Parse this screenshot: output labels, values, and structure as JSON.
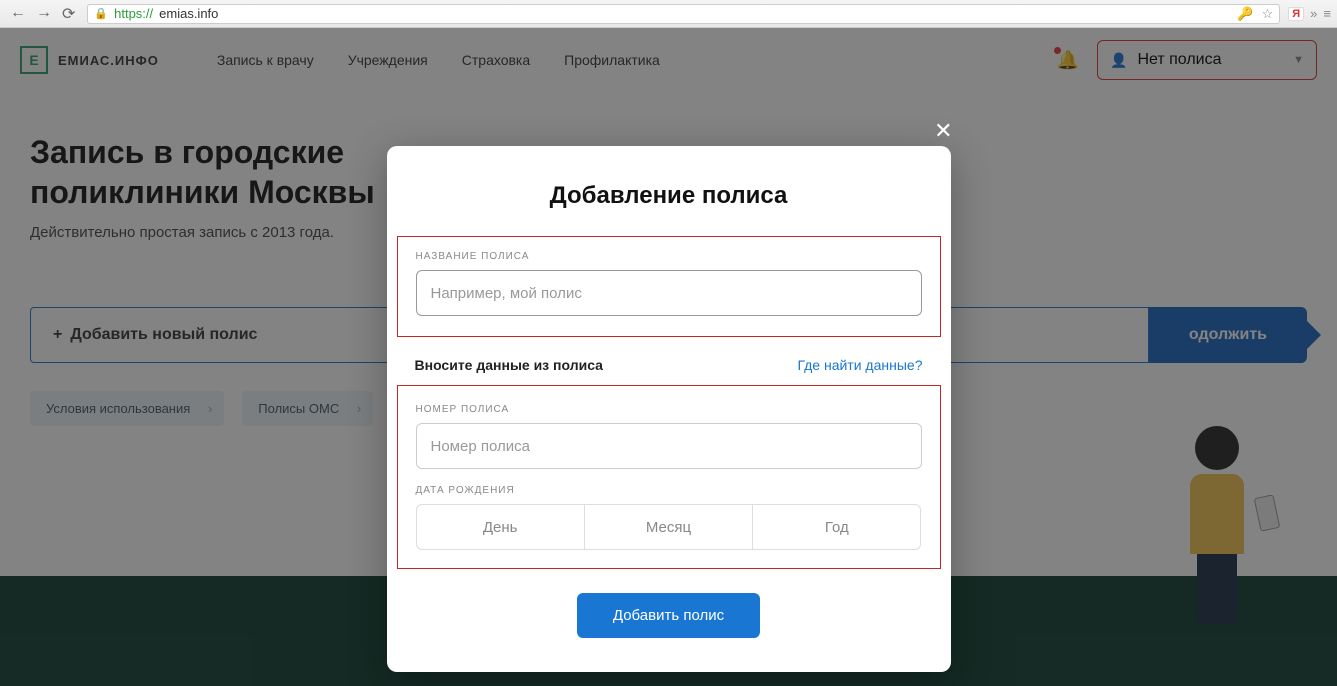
{
  "browser": {
    "url_scheme": "https://",
    "url_host": "emias.info"
  },
  "header": {
    "logo_letter": "Е",
    "logo_text": "ЕМИАС.ИНФО",
    "nav": [
      "Запись к врачу",
      "Учреждения",
      "Страховка",
      "Профилактика"
    ],
    "policy_dropdown": "Нет полиса"
  },
  "hero": {
    "title_line1": "Запись в городские",
    "title_line2": "поликлиники Москвы",
    "subtitle": "Действительно простая запись с 2013 года."
  },
  "cta": {
    "add_label": "Добавить новый полис",
    "continue_label": "одолжить"
  },
  "chips": [
    "Условия использования",
    "Полисы ОМС"
  ],
  "modal": {
    "title": "Добавление полиса",
    "name_label": "НАЗВАНИЕ ПОЛИСА",
    "name_placeholder": "Например, мой полис",
    "helper_left": "Вносите данные из полиса",
    "helper_right": "Где найти данные?",
    "number_label": "НОМЕР ПОЛИСА",
    "number_placeholder": "Номер полиса",
    "dob_label": "ДАТА РОЖДЕНИЯ",
    "dob_day": "День",
    "dob_month": "Месяц",
    "dob_year": "Год",
    "submit": "Добавить полис"
  }
}
